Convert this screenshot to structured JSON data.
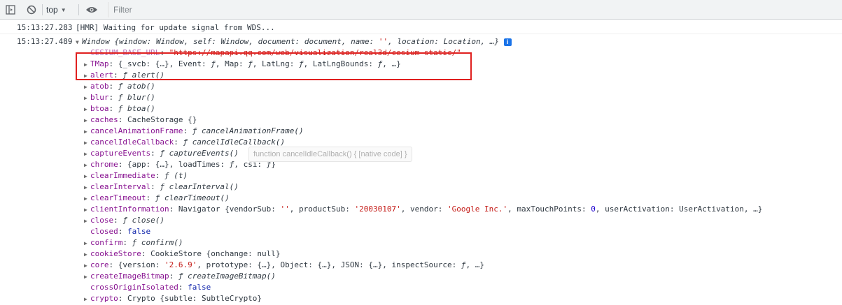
{
  "toolbar": {
    "context": "top",
    "filter_placeholder": "Filter",
    "icons": [
      "sidebar-toggle-icon",
      "clear-console-icon",
      "dropdown-arrow-icon",
      "eye-icon"
    ]
  },
  "messages": [
    {
      "timestamp": "15:13:27.283",
      "text": "[HMR] Waiting for update signal from WDS..."
    },
    {
      "timestamp": "15:13:27.489",
      "text": "Window {window: Window, self: Window, document: document, name: '', location: Location, …}"
    }
  ],
  "window_summary": {
    "prefix": "Window ",
    "body": "{window: Window, self: Window, document: document, name: ",
    "name_val": "''",
    "tail": ", location: Location, …}"
  },
  "properties": [
    {
      "arrow": "",
      "key": "CESIUM_BASE_URL",
      "sep": ": ",
      "value": "\"https://mapapi.qq.com/web/visualization/real3d/cesium-static/\"",
      "kind": "str",
      "dim": true
    },
    {
      "arrow": "▶",
      "key": "TMap",
      "sep": ": ",
      "value": "{_svcb: {…}, Event: ƒ, Map: ƒ, LatLng: ƒ, LatLngBounds: ƒ, …}",
      "kind": "plain"
    },
    {
      "arrow": "▶",
      "key": "alert",
      "sep": ": ",
      "value": "ƒ alert()",
      "kind": "fn"
    },
    {
      "arrow": "▶",
      "key": "atob",
      "sep": ": ",
      "value": "ƒ atob()",
      "kind": "fn"
    },
    {
      "arrow": "▶",
      "key": "blur",
      "sep": ": ",
      "value": "ƒ blur()",
      "kind": "fn"
    },
    {
      "arrow": "▶",
      "key": "btoa",
      "sep": ": ",
      "value": "ƒ btoa()",
      "kind": "fn"
    },
    {
      "arrow": "▶",
      "key": "caches",
      "sep": ": ",
      "value": "CacheStorage {}",
      "kind": "plain"
    },
    {
      "arrow": "▶",
      "key": "cancelAnimationFrame",
      "sep": ": ",
      "value": "ƒ cancelAnimationFrame()",
      "kind": "fn"
    },
    {
      "arrow": "▶",
      "key": "cancelIdleCallback",
      "sep": ": ",
      "value": "ƒ cancelIdleCallback()",
      "kind": "fn"
    },
    {
      "arrow": "▶",
      "key": "captureEvents",
      "sep": ": ",
      "value": "ƒ captureEvents()",
      "kind": "fn"
    },
    {
      "arrow": "▶",
      "key": "chrome",
      "sep": ": ",
      "value": "{app: {…}, loadTimes: ƒ, csi: ƒ}",
      "kind": "plain"
    },
    {
      "arrow": "▶",
      "key": "clearImmediate",
      "sep": ": ",
      "value": "ƒ (t)",
      "kind": "fn"
    },
    {
      "arrow": "▶",
      "key": "clearInterval",
      "sep": ": ",
      "value": "ƒ clearInterval()",
      "kind": "fn"
    },
    {
      "arrow": "▶",
      "key": "clearTimeout",
      "sep": ": ",
      "value": "ƒ clearTimeout()",
      "kind": "fn"
    },
    {
      "arrow": "▶",
      "key": "clientInformation",
      "sep": ": ",
      "value": "Navigator {vendorSub: '', productSub: '20030107', vendor: 'Google Inc.', maxTouchPoints: 0, userActivation: UserActivation, …}",
      "kind": "navigator"
    },
    {
      "arrow": "▶",
      "key": "close",
      "sep": ": ",
      "value": "ƒ close()",
      "kind": "fn"
    },
    {
      "arrow": "",
      "key": "closed",
      "sep": ": ",
      "value": "false",
      "kind": "kw"
    },
    {
      "arrow": "▶",
      "key": "confirm",
      "sep": ": ",
      "value": "ƒ confirm()",
      "kind": "fn"
    },
    {
      "arrow": "▶",
      "key": "cookieStore",
      "sep": ": ",
      "value": "CookieStore {onchange: null}",
      "kind": "plain"
    },
    {
      "arrow": "▶",
      "key": "core",
      "sep": ": ",
      "value": "{version: '2.6.9', prototype: {…}, Object: {…}, JSON: {…}, inspectSource: ƒ, …}",
      "kind": "core"
    },
    {
      "arrow": "▶",
      "key": "createImageBitmap",
      "sep": ": ",
      "value": "ƒ createImageBitmap()",
      "kind": "fn"
    },
    {
      "arrow": "",
      "key": "crossOriginIsolated",
      "sep": ": ",
      "value": "false",
      "kind": "kw"
    },
    {
      "arrow": "▶",
      "key": "crypto",
      "sep": ": ",
      "value": "Crypto {subtle: SubtleCrypto}",
      "kind": "plain"
    }
  ],
  "tooltip": "function cancelIdleCallback() { [native code] }",
  "colors": {
    "highlight_box": "#e0201f",
    "key": "#881391",
    "string": "#c41a16",
    "number": "#1c00cf",
    "keyword": "#0d22aa"
  }
}
